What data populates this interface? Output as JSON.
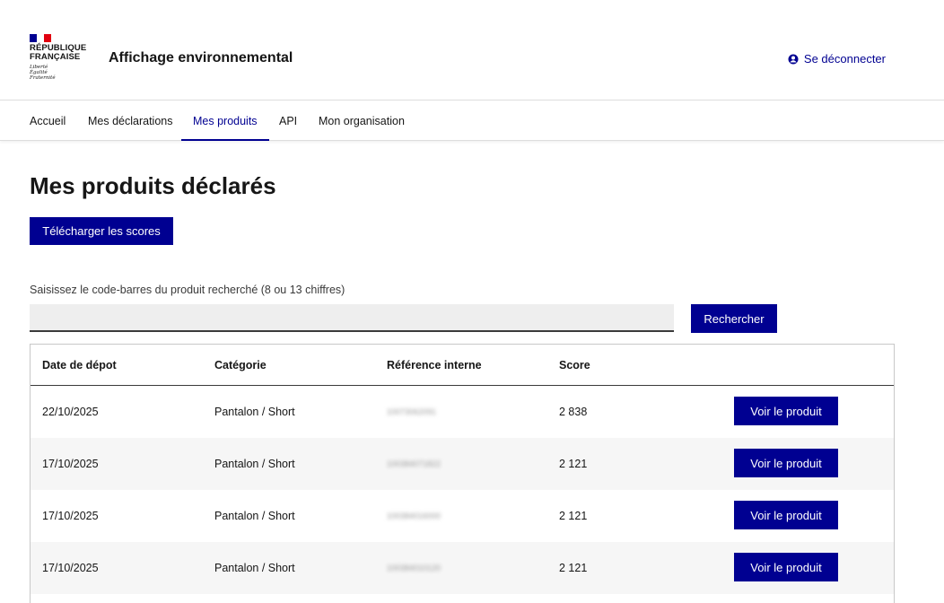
{
  "header": {
    "logo": {
      "line1": "RÉPUBLIQUE",
      "line2": "FRANÇAISE",
      "motto": [
        "Liberté",
        "Égalité",
        "Fraternité"
      ]
    },
    "title": "Affichage environnemental",
    "logout_label": "Se déconnecter"
  },
  "nav": {
    "items": [
      {
        "label": "Accueil"
      },
      {
        "label": "Mes déclarations"
      },
      {
        "label": "Mes produits"
      },
      {
        "label": "API"
      },
      {
        "label": "Mon organisation"
      }
    ],
    "active": "Mes produits"
  },
  "main": {
    "title": "Mes produits déclarés",
    "download_label": "Télécharger les scores",
    "search": {
      "label": "Saisissez le code-barres du produit recherché (8 ou 13 chiffres)",
      "value": "",
      "button_label": "Rechercher"
    },
    "table": {
      "headers": [
        "Date de dépot",
        "Catégorie",
        "Référence interne",
        "Score",
        ""
      ],
      "rows": [
        {
          "date": "22/10/2025",
          "category": "Pantalon / Short",
          "reference": "10073062091",
          "score": "2 838",
          "action": "Voir le produit"
        },
        {
          "date": "17/10/2025",
          "category": "Pantalon / Short",
          "reference": "100384071822",
          "score": "2 121",
          "action": "Voir le produit"
        },
        {
          "date": "17/10/2025",
          "category": "Pantalon / Short",
          "reference": "100384016000",
          "score": "2 121",
          "action": "Voir le produit"
        },
        {
          "date": "17/10/2025",
          "category": "Pantalon / Short",
          "reference": "100384010120",
          "score": "2 121",
          "action": "Voir le produit"
        }
      ]
    }
  },
  "colors": {
    "primary": "#000091",
    "flag_red": "#e1000f"
  }
}
